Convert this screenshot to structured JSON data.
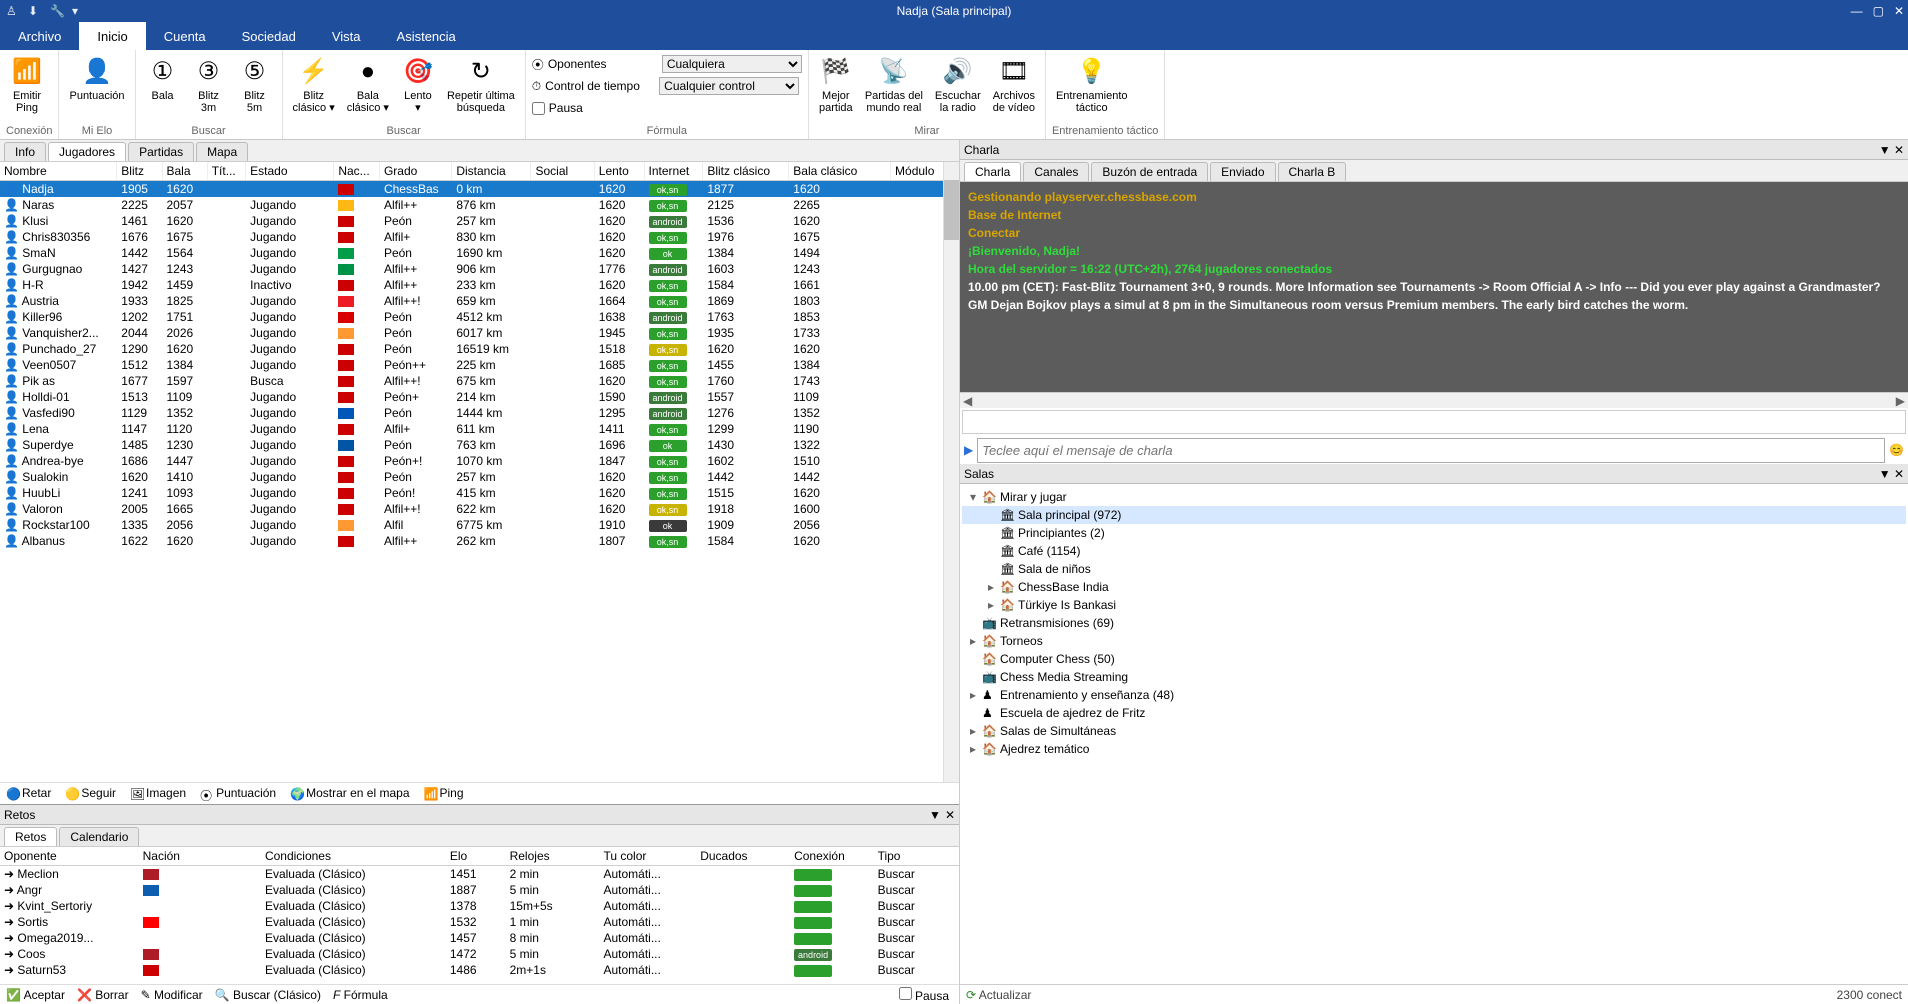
{
  "window": {
    "title": "Nadja (Sala principal)"
  },
  "menu": {
    "items": [
      "Archivo",
      "Inicio",
      "Cuenta",
      "Sociedad",
      "Vista",
      "Asistencia"
    ],
    "active": 1
  },
  "ribbon": {
    "groups": [
      {
        "title": "Conexión",
        "buttons": [
          {
            "label": "Emitir\nPing",
            "icon": "📶"
          }
        ]
      },
      {
        "title": "Mi Elo",
        "buttons": [
          {
            "label": "Puntuación",
            "icon": "👤"
          }
        ]
      },
      {
        "title": "Buscar",
        "buttons": [
          {
            "label": "Bala",
            "icon": "①"
          },
          {
            "label": "Blitz\n3m",
            "icon": "③"
          },
          {
            "label": "Blitz\n5m",
            "icon": "⑤"
          }
        ]
      },
      {
        "title": "Buscar",
        "buttons": [
          {
            "label": "Blitz\nclásico ▾",
            "icon": "⚡"
          },
          {
            "label": "Bala\nclásico ▾",
            "icon": "●"
          },
          {
            "label": "Lento\n▾",
            "icon": "🎯"
          },
          {
            "label": "Repetir última\nbúsqueda",
            "icon": "↻"
          }
        ]
      },
      {
        "title": "Fórmula",
        "form": {
          "oponentes_label": "Oponentes",
          "oponentes_value": "Cualquiera",
          "control_label": "Control de tiempo",
          "control_value": "Cualquier control",
          "pausa_label": "Pausa"
        }
      },
      {
        "title": "Mirar",
        "buttons": [
          {
            "label": "Mejor\npartida",
            "icon": "🏁"
          },
          {
            "label": "Partidas del\nmundo real",
            "icon": "📡"
          },
          {
            "label": "Escuchar\nla radio",
            "icon": "🔊"
          },
          {
            "label": "Archivos\nde vídeo",
            "icon": "🎞"
          }
        ]
      },
      {
        "title": "Entrenamiento táctico",
        "buttons": [
          {
            "label": "Entrenamiento\ntáctico",
            "icon": "💡"
          }
        ]
      }
    ]
  },
  "left_tabs": {
    "items": [
      "Info",
      "Jugadores",
      "Partidas",
      "Mapa"
    ],
    "active": 1
  },
  "players": {
    "columns": [
      "Nombre",
      "Blitz",
      "Bala",
      "Tít...",
      "Estado",
      "Nac...",
      "Grado",
      "Distancia",
      "Social",
      "Lento",
      "Internet",
      "Blitz clásico",
      "Bala clásico",
      "Módulo"
    ],
    "rows": [
      {
        "name": "Nadja",
        "blitz": "1905",
        "bala": "1620",
        "tit": "",
        "estado": "",
        "flag": "#cc0000",
        "grado": "ChessBas",
        "dist": "0 km",
        "lento": "1620",
        "net_lbl": "ok,sn",
        "net_bg": "#2ca02c",
        "bclas": "1877",
        "balaC": "1620",
        "sel": true
      },
      {
        "name": "Naras",
        "blitz": "2225",
        "bala": "2057",
        "estado": "Jugando",
        "flag": "#fdb813",
        "grado": "Alfil++",
        "dist": "876 km",
        "lento": "1620",
        "net_lbl": "ok,sn",
        "net_bg": "#2ca02c",
        "bclas": "2125",
        "balaC": "2265"
      },
      {
        "name": "Klusi",
        "blitz": "1461",
        "bala": "1620",
        "estado": "Jugando",
        "flag": "#cc0000",
        "grado": "Peón",
        "dist": "257 km",
        "lento": "1620",
        "net_lbl": "android",
        "net_bg": "#3a7a3a",
        "bclas": "1536",
        "balaC": "1620"
      },
      {
        "name": "Chris830356",
        "blitz": "1676",
        "bala": "1675",
        "estado": "Jugando",
        "flag": "#cc0000",
        "grado": "Alfil+",
        "dist": "830 km",
        "lento": "1620",
        "net_lbl": "ok,sn",
        "net_bg": "#2ca02c",
        "bclas": "1976",
        "balaC": "1675"
      },
      {
        "name": "SmaN",
        "blitz": "1442",
        "bala": "1564",
        "estado": "Jugando",
        "flag": "#009e49",
        "grado": "Peón",
        "dist": "1690 km",
        "lento": "1620",
        "net_lbl": "ok",
        "net_bg": "#2ca02c",
        "bclas": "1384",
        "balaC": "1494"
      },
      {
        "name": "Gurgugnao",
        "blitz": "1427",
        "bala": "1243",
        "estado": "Jugando",
        "flag": "#009246",
        "grado": "Alfil++",
        "dist": "906 km",
        "lento": "1776",
        "net_lbl": "android",
        "net_bg": "#3a7a3a",
        "bclas": "1603",
        "balaC": "1243"
      },
      {
        "name": "H-R",
        "blitz": "1942",
        "bala": "1459",
        "estado": "Inactivo",
        "flag": "#cc0000",
        "grado": "Alfil++",
        "dist": "233 km",
        "lento": "1620",
        "net_lbl": "ok,sn",
        "net_bg": "#2ca02c",
        "bclas": "1584",
        "balaC": "1661"
      },
      {
        "name": "Austria",
        "blitz": "1933",
        "bala": "1825",
        "estado": "Jugando",
        "flag": "#ed1c24",
        "grado": "Alfil++!",
        "dist": "659 km",
        "lento": "1664",
        "net_lbl": "ok,sn",
        "net_bg": "#2ca02c",
        "bclas": "1869",
        "balaC": "1803"
      },
      {
        "name": "Killer96",
        "blitz": "1202",
        "bala": "1751",
        "estado": "Jugando",
        "flag": "#d90000",
        "grado": "Peón",
        "dist": "4512 km",
        "lento": "1638",
        "net_lbl": "android",
        "net_bg": "#3a7a3a",
        "bclas": "1763",
        "balaC": "1853"
      },
      {
        "name": "Vanquisher2...",
        "blitz": "2044",
        "bala": "2026",
        "estado": "Jugando",
        "flag": "#ff9933",
        "grado": "Peón",
        "dist": "6017 km",
        "lento": "1945",
        "net_lbl": "ok,sn",
        "net_bg": "#2ca02c",
        "bclas": "1935",
        "balaC": "1733"
      },
      {
        "name": "Punchado_27",
        "blitz": "1290",
        "bala": "1620",
        "estado": "Jugando",
        "flag": "#cc0000",
        "grado": "Peón",
        "dist": "16519 km",
        "lento": "1518",
        "net_lbl": "ok,sn",
        "net_bg": "#c8b400",
        "bclas": "1620",
        "balaC": "1620"
      },
      {
        "name": "Veen0507",
        "blitz": "1512",
        "bala": "1384",
        "estado": "Jugando",
        "flag": "#cc0000",
        "grado": "Peón++",
        "dist": "225 km",
        "lento": "1685",
        "net_lbl": "ok,sn",
        "net_bg": "#2ca02c",
        "bclas": "1455",
        "balaC": "1384"
      },
      {
        "name": "Pik as",
        "blitz": "1677",
        "bala": "1597",
        "estado": "Busca",
        "flag": "#cc0000",
        "grado": "Alfil++!",
        "dist": "675 km",
        "lento": "1620",
        "net_lbl": "ok,sn",
        "net_bg": "#2ca02c",
        "bclas": "1760",
        "balaC": "1743"
      },
      {
        "name": "Holldi-01",
        "blitz": "1513",
        "bala": "1109",
        "estado": "Jugando",
        "flag": "#cc0000",
        "grado": "Peón+",
        "dist": "214 km",
        "lento": "1590",
        "net_lbl": "android",
        "net_bg": "#3a7a3a",
        "bclas": "1557",
        "balaC": "1109"
      },
      {
        "name": "Vasfedi90",
        "blitz": "1129",
        "bala": "1352",
        "estado": "Jugando",
        "flag": "#0057b7",
        "grado": "Peón",
        "dist": "1444 km",
        "lento": "1295",
        "net_lbl": "android",
        "net_bg": "#3a7a3a",
        "bclas": "1276",
        "balaC": "1352"
      },
      {
        "name": "Lena",
        "blitz": "1147",
        "bala": "1120",
        "estado": "Jugando",
        "flag": "#cc0000",
        "grado": "Alfil+",
        "dist": "611 km",
        "lento": "1411",
        "net_lbl": "ok,sn",
        "net_bg": "#2ca02c",
        "bclas": "1299",
        "balaC": "1190"
      },
      {
        "name": "Superdye",
        "blitz": "1485",
        "bala": "1230",
        "estado": "Jugando",
        "flag": "#0055a4",
        "grado": "Peón",
        "dist": "763 km",
        "lento": "1696",
        "net_lbl": "ok",
        "net_bg": "#2ca02c",
        "bclas": "1430",
        "balaC": "1322"
      },
      {
        "name": "Andrea-bye",
        "blitz": "1686",
        "bala": "1447",
        "estado": "Jugando",
        "flag": "#cc0000",
        "grado": "Peón+!",
        "dist": "1070 km",
        "lento": "1847",
        "net_lbl": "ok,sn",
        "net_bg": "#2ca02c",
        "bclas": "1602",
        "balaC": "1510"
      },
      {
        "name": "Sualokin",
        "blitz": "1620",
        "bala": "1410",
        "estado": "Jugando",
        "flag": "#cc0000",
        "grado": "Peón",
        "dist": "257 km",
        "lento": "1620",
        "net_lbl": "ok,sn",
        "net_bg": "#2ca02c",
        "bclas": "1442",
        "balaC": "1442"
      },
      {
        "name": "HuubLi",
        "blitz": "1241",
        "bala": "1093",
        "estado": "Jugando",
        "flag": "#cc0000",
        "grado": "Peón!",
        "dist": "415 km",
        "lento": "1620",
        "net_lbl": "ok,sn",
        "net_bg": "#2ca02c",
        "bclas": "1515",
        "balaC": "1620"
      },
      {
        "name": "Valoron",
        "blitz": "2005",
        "bala": "1665",
        "estado": "Jugando",
        "flag": "#cc0000",
        "grado": "Alfil++!",
        "dist": "622 km",
        "lento": "1620",
        "net_lbl": "ok,sn",
        "net_bg": "#c8b400",
        "bclas": "1918",
        "balaC": "1600"
      },
      {
        "name": "Rockstar100",
        "blitz": "1335",
        "bala": "2056",
        "estado": "Jugando",
        "flag": "#ff9933",
        "grado": "Alfil",
        "dist": "6775 km",
        "lento": "1910",
        "net_lbl": "ok",
        "net_bg": "#3a3a3a",
        "bclas": "1909",
        "balaC": "2056"
      },
      {
        "name": "Albanus",
        "blitz": "1622",
        "bala": "1620",
        "estado": "Jugando",
        "flag": "#cc0000",
        "grado": "Alfil++",
        "dist": "262 km",
        "lento": "1807",
        "net_lbl": "ok,sn",
        "net_bg": "#2ca02c",
        "bclas": "1584",
        "balaC": "1620"
      }
    ]
  },
  "players_toolbar": {
    "items": [
      "Retar",
      "Seguir",
      "Imagen",
      "Puntuación",
      "Mostrar en el mapa",
      "Ping"
    ]
  },
  "retos": {
    "title": "Retos",
    "tabs": [
      "Retos",
      "Calendario"
    ],
    "active": 0,
    "columns": [
      "Oponente",
      "Nación",
      "Condiciones",
      "Elo",
      "Relojes",
      "Tu color",
      "Ducados",
      "Conexión",
      "Tipo"
    ],
    "rows": [
      {
        "op": "Meclion",
        "flag": "#ae1c28",
        "cond": "Evaluada (Clásico)",
        "elo": "1451",
        "rel": "2 min",
        "col": "Automáti...",
        "conn": "#2ca02c",
        "tipo": "Buscar"
      },
      {
        "op": "Angr",
        "flag": "#0d5eaf",
        "cond": "Evaluada (Clásico)",
        "elo": "1887",
        "rel": "5 min",
        "col": "Automáti...",
        "conn": "#2ca02c",
        "tipo": "Buscar"
      },
      {
        "op": "Kvint_Sertoriy",
        "flag": "",
        "cond": "Evaluada (Clásico)",
        "elo": "1378",
        "rel": "15m+5s",
        "col": "Automáti...",
        "conn": "#2ca02c",
        "tipo": "Buscar"
      },
      {
        "op": "Sortis",
        "flag": "#ff0000",
        "cond": "Evaluada (Clásico)",
        "elo": "1532",
        "rel": "1 min",
        "col": "Automáti...",
        "conn": "#2ca02c",
        "tipo": "Buscar"
      },
      {
        "op": "Omega2019...",
        "flag": "",
        "cond": "Evaluada (Clásico)",
        "elo": "1457",
        "rel": "8 min",
        "col": "Automáti...",
        "conn": "#2ca02c",
        "tipo": "Buscar"
      },
      {
        "op": "Coos",
        "flag": "#ae1c28",
        "cond": "Evaluada (Clásico)",
        "elo": "1472",
        "rel": "5 min",
        "col": "Automáti...",
        "conn": "#3a7a3a",
        "conn_lbl": "android",
        "tipo": "Buscar"
      },
      {
        "op": "Saturn53",
        "flag": "#cc0000",
        "cond": "Evaluada (Clásico)",
        "elo": "1486",
        "rel": "2m+1s",
        "col": "Automáti...",
        "conn": "#2ca02c",
        "tipo": "Buscar"
      }
    ],
    "bar": [
      "Aceptar",
      "Borrar",
      "Modificar",
      "Buscar (Clásico)",
      "Fórmula"
    ],
    "pausa": "Pausa"
  },
  "chat": {
    "title": "Charla",
    "tabs": [
      "Charla",
      "Canales",
      "Buzón de entrada",
      "Enviado",
      "Charla B"
    ],
    "active": 0,
    "lines": [
      {
        "cls": "mng",
        "text": "Gestionando playserver.chessbase.com"
      },
      {
        "cls": "mng",
        "text": "Base de Internet"
      },
      {
        "cls": "mng",
        "text": "Conectar"
      },
      {
        "cls": "sys",
        "text": "¡Bienvenido, Nadja!"
      },
      {
        "cls": "sys",
        "text": "Hora del servidor = 16:22 (UTC+2h), 2764 jugadores conectados"
      },
      {
        "cls": "ann",
        "text": "10.00 pm (CET): Fast-Blitz Tournament 3+0, 9 rounds. More Information see Tournaments -> Room Official A -> Info --- Did you ever play against a Grandmaster? GM Dejan Bojkov plays a simul at 8 pm in the Simultaneous room versus Premium members. The early bird catches the worm."
      }
    ],
    "placeholder": "Teclee aquí el mensaje de charla"
  },
  "rooms": {
    "title": "Salas",
    "nodes": [
      {
        "depth": 0,
        "exp": "▾",
        "icon": "🏠",
        "label": "Mirar y jugar"
      },
      {
        "depth": 1,
        "exp": "",
        "icon": "🏛",
        "label": "Sala principal  (972)",
        "sel": true
      },
      {
        "depth": 1,
        "exp": "",
        "icon": "🏛",
        "label": "Principiantes  (2)"
      },
      {
        "depth": 1,
        "exp": "",
        "icon": "🏛",
        "label": "Café  (1154)"
      },
      {
        "depth": 1,
        "exp": "",
        "icon": "🏛",
        "label": "Sala de niños"
      },
      {
        "depth": 1,
        "exp": "▸",
        "icon": "🏠",
        "label": "ChessBase India"
      },
      {
        "depth": 1,
        "exp": "▸",
        "icon": "🏠",
        "label": "Türkiye Is Bankasi"
      },
      {
        "depth": 0,
        "exp": "",
        "icon": "📺",
        "label": "Retransmisiones  (69)"
      },
      {
        "depth": 0,
        "exp": "▸",
        "icon": "🏠",
        "label": "Torneos"
      },
      {
        "depth": 0,
        "exp": "",
        "icon": "🏠",
        "label": "Computer Chess  (50)"
      },
      {
        "depth": 0,
        "exp": "",
        "icon": "📺",
        "label": "Chess Media Streaming"
      },
      {
        "depth": 0,
        "exp": "▸",
        "icon": "♟",
        "label": "Entrenamiento y enseñanza  (48)"
      },
      {
        "depth": 0,
        "exp": "",
        "icon": "♟",
        "label": "Escuela de ajedrez de Fritz"
      },
      {
        "depth": 0,
        "exp": "▸",
        "icon": "🏠",
        "label": "Salas de Simultáneas"
      },
      {
        "depth": 0,
        "exp": "▸",
        "icon": "🏠",
        "label": "Ajedrez temático"
      }
    ],
    "status_left": "Actualizar",
    "status_right": "2300 conect"
  }
}
